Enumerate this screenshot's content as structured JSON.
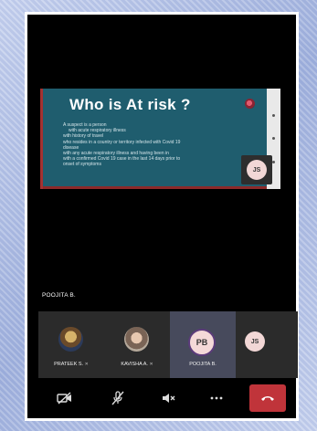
{
  "presentation": {
    "title": "Who is At risk ?",
    "lines": [
      "A suspect is a person",
      "with acute respiratory illness",
      "with history of travel",
      "who resides in a country or territory infected with Covid 19",
      "disease",
      "with any acute respiratory illness and having been in",
      "with a confirmed Covid 19 case in the last 14 days prior to",
      "onset of symptoms"
    ]
  },
  "self_tile": {
    "initials": "JS"
  },
  "presenter": {
    "name": "POOJITA B."
  },
  "participants": [
    {
      "name": "PRATEEK S.",
      "initials": ""
    },
    {
      "name": "KAVISHA A.",
      "initials": ""
    },
    {
      "name": "POOJITA B.",
      "initials": "PB"
    },
    {
      "name": "",
      "initials": "JS"
    }
  ],
  "controls": {
    "camera_icon": "camera-off-icon",
    "mic_icon": "mic-off-icon",
    "speaker_icon": "speaker-off-icon",
    "more_icon": "more-icon",
    "end_call_icon": "end-call-icon",
    "end_call_color": "#c0343a"
  }
}
